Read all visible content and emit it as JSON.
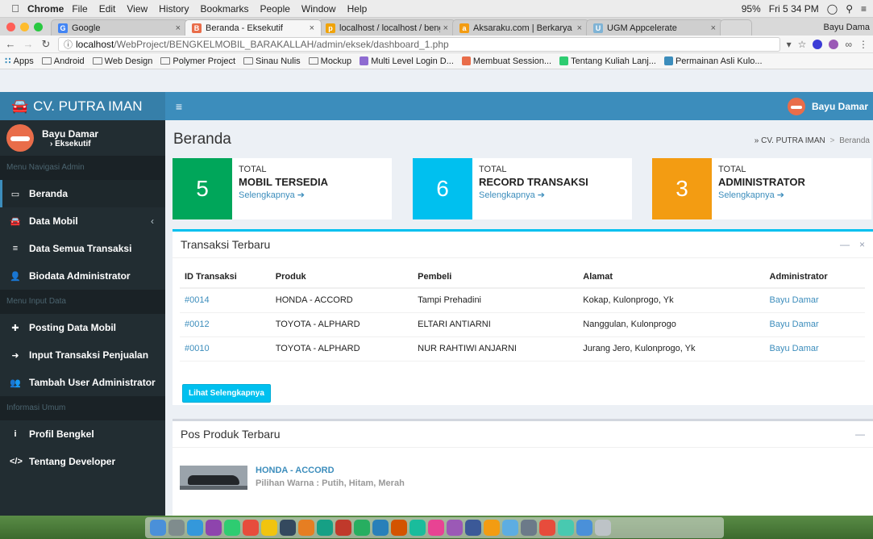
{
  "os_menubar": {
    "app_name": "Chrome",
    "menus": [
      "File",
      "Edit",
      "View",
      "History",
      "Bookmarks",
      "People",
      "Window",
      "Help"
    ],
    "battery": "95%",
    "clock": "Fri 5 34 PM"
  },
  "browser": {
    "tabs": [
      {
        "title": "Google",
        "favicon_color": "#4285f4",
        "favicon_char": "G",
        "active": false
      },
      {
        "title": "Beranda - Eksekutif",
        "favicon_color": "#e96d4a",
        "favicon_char": "B",
        "active": true
      },
      {
        "title": "localhost / localhost / bengk",
        "favicon_color": "#f0a30a",
        "favicon_char": "p",
        "active": false
      },
      {
        "title": "Aksaraku.com | Berkarya Ad",
        "favicon_color": "#f39c12",
        "favicon_char": "a",
        "active": false
      },
      {
        "title": "UGM Appcelerate",
        "favicon_color": "#7fb3d5",
        "favicon_char": "U",
        "active": false
      }
    ],
    "profile_name": "Bayu Dama",
    "url_host": "localhost",
    "url_path": "/WebProject/BENGKELMOBIL_BARAKALLAH/admin/eksek/dashboard_1.php",
    "bookmarks": [
      {
        "label": "Apps",
        "kind": "apps"
      },
      {
        "label": "Android",
        "kind": "folder"
      },
      {
        "label": "Web Design",
        "kind": "folder"
      },
      {
        "label": "Polymer Project",
        "kind": "folder"
      },
      {
        "label": "Sinau Nulis",
        "kind": "folder"
      },
      {
        "label": "Mockup",
        "kind": "folder"
      },
      {
        "label": "Multi Level Login D...",
        "kind": "site",
        "color": "#8e6bd1"
      },
      {
        "label": "Membuat Session...",
        "kind": "site",
        "color": "#e96d4a"
      },
      {
        "label": "Tentang Kuliah Lanj...",
        "kind": "site",
        "color": "#2ecc71"
      },
      {
        "label": "Permainan Asli Kulo...",
        "kind": "site",
        "color": "#3c8dbc"
      }
    ]
  },
  "app": {
    "brand": "CV. PUTRA IMAN",
    "header_user": "Bayu Damar",
    "sidebar": {
      "user_name": "Bayu Damar",
      "user_role": "Eksekutif",
      "sections": [
        {
          "title": "Menu Navigasi Admin",
          "items": [
            {
              "label": "Beranda",
              "icon": "monitor-icon",
              "glyph": "▭",
              "active": true
            },
            {
              "label": "Data Mobil",
              "icon": "car-icon",
              "glyph": "🚘",
              "has_chevron": true
            },
            {
              "label": "Data Semua Transaksi",
              "icon": "list-icon",
              "glyph": "≡"
            },
            {
              "label": "Biodata Administrator",
              "icon": "user-icon",
              "glyph": "👤"
            }
          ]
        },
        {
          "title": "Menu Input Data",
          "items": [
            {
              "label": "Posting Data Mobil",
              "icon": "plus-square-icon",
              "glyph": "✚"
            },
            {
              "label": "Input Transaksi Penjualan",
              "icon": "arrow-circle-icon",
              "glyph": "➜"
            },
            {
              "label": "Tambah User Administrator",
              "icon": "user-plus-icon",
              "glyph": "👥"
            }
          ]
        },
        {
          "title": "Informasi Umum",
          "items": [
            {
              "label": "Profil Bengkel",
              "icon": "info-icon",
              "glyph": "i"
            },
            {
              "label": "Tentang Developer",
              "icon": "code-icon",
              "glyph": "</>"
            }
          ]
        }
      ]
    },
    "page_title": "Beranda",
    "breadcrumb": {
      "root": "CV. PUTRA IMAN",
      "current": "Beranda"
    },
    "stats": [
      {
        "value": "5",
        "label_top": "TOTAL",
        "label_main": "MOBIL TERSEDIA",
        "link": "Selengkapnya",
        "color": "#00a65a"
      },
      {
        "value": "6",
        "label_top": "TOTAL",
        "label_main": "RECORD TRANSAKSI",
        "link": "Selengkapnya",
        "color": "#00c0ef"
      },
      {
        "value": "3",
        "label_top": "TOTAL",
        "label_main": "ADMINISTRATOR",
        "link": "Selengkapnya",
        "color": "#f39c12"
      }
    ],
    "transactions": {
      "title": "Transaksi Terbaru",
      "columns": [
        "ID Transaksi",
        "Produk",
        "Pembeli",
        "Alamat",
        "Administrator"
      ],
      "rows": [
        [
          "#0014",
          "HONDA - ACCORD",
          "Tampi Prehadini",
          "Kokap, Kulonprogo, Yk",
          "Bayu Damar"
        ],
        [
          "#0012",
          "TOYOTA - ALPHARD",
          "ELTARI ANTIARNI",
          "Nanggulan, Kulonprogo",
          "Bayu Damar"
        ],
        [
          "#0010",
          "TOYOTA - ALPHARD",
          "NUR RAHTIWI ANJARNI",
          "Jurang Jero, Kulonprogo, Yk",
          "Bayu Damar"
        ]
      ],
      "button_label": "Lihat Selengkapnya"
    },
    "products": {
      "title": "Pos Produk Terbaru",
      "items": [
        {
          "name": "HONDA - ACCORD",
          "desc": "Pilihan Warna : Putih, Hitam, Merah"
        }
      ]
    }
  },
  "dock": {
    "icon_colors": [
      "#4a90d9",
      "#7f8c8d",
      "#3498db",
      "#8e44ad",
      "#2ecc71",
      "#e74c3c",
      "#f1c40f",
      "#34495e",
      "#e67e22",
      "#16a085",
      "#c0392b",
      "#27ae60",
      "#2980b9",
      "#d35400",
      "#1abc9c",
      "#e84393",
      "#9b59b6",
      "#3b5998",
      "#f39c12",
      "#5dade2",
      "#6c7a89",
      "#e74c3c",
      "#48c9b0",
      "#4a90d9",
      "#bdc3c7"
    ]
  }
}
